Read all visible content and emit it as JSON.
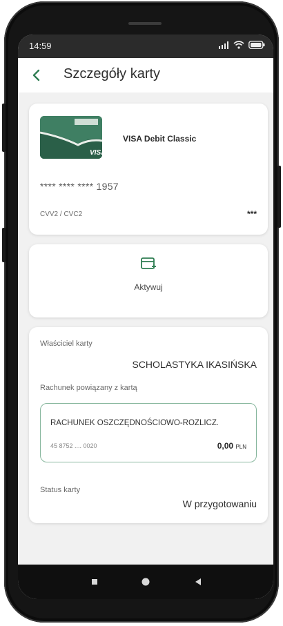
{
  "status_bar": {
    "time": "14:59"
  },
  "header": {
    "back_icon": "chevron-left-icon",
    "title": "Szczegóły karty"
  },
  "card": {
    "name": "VISA Debit Classic",
    "brand": "VISA",
    "number_masked": "**** **** **** 1957",
    "cvv_label": "CVV2 / CVC2",
    "cvv_value": "***"
  },
  "activate": {
    "label": "Aktywuj",
    "icon": "card-add-icon"
  },
  "details": {
    "owner_label": "Właściciel karty",
    "owner_value": "SCHOLASTYKA IKASIŃSKA",
    "account_label": "Rachunek powiązany z kartą",
    "account": {
      "name": "RACHUNEK OSZCZĘDNOŚCIOWO-ROZLICZ.",
      "number": "45 8752 .... 0020",
      "balance": "0,00",
      "currency": "PLN"
    },
    "status_label": "Status karty",
    "status_value": "W przygotowaniu"
  },
  "colors": {
    "accent": "#2e7d52",
    "account_border": "#88b79e"
  }
}
